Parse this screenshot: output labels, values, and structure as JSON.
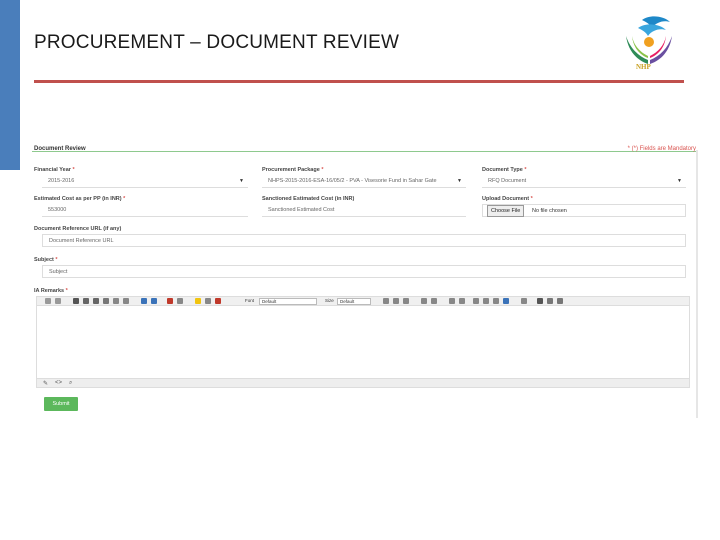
{
  "slide": {
    "title": "PROCUREMENT – DOCUMENT REVIEW",
    "logo_text": "NHP"
  },
  "form": {
    "title": "Document Review",
    "mandatory_note": "* (*) Fields are Mandatory",
    "financial_year": {
      "label": "Financial Year",
      "value": "2015-2016"
    },
    "procurement_package": {
      "label": "Procurement Package",
      "value": "NHPS-2015-2016-ESA-16/05/2 - PVA - Visesorie Fund in Sahar Gate"
    },
    "document_type": {
      "label": "Document Type",
      "value": "RFQ Document"
    },
    "estimated_cost": {
      "label": "Estimated Cost as per PP (in INR)",
      "value": "553000"
    },
    "sanctioned_cost": {
      "label": "Sanctioned Estimated Cost (in INR)",
      "placeholder": "Sanctioned Estimated Cost"
    },
    "upload": {
      "label": "Upload Document",
      "button": "Choose File",
      "status": "No file chosen"
    },
    "doc_url": {
      "label": "Document Reference URL (if any)",
      "placeholder": "Document Reference URL"
    },
    "subject": {
      "label": "Subject",
      "placeholder": "Subject"
    },
    "remarks": {
      "label": "IA Remarks"
    },
    "toolbar": {
      "font_label": "Font",
      "font_value": "Default",
      "size_label": "Size",
      "size_value": "Default"
    },
    "submit": "Submit"
  },
  "colors": {
    "accent_bar": "#4a7ebb",
    "title_rule": "#c0504d",
    "submit": "#5cb85c",
    "form_divider": "#8ec98e",
    "mandatory": "#d9534f"
  }
}
